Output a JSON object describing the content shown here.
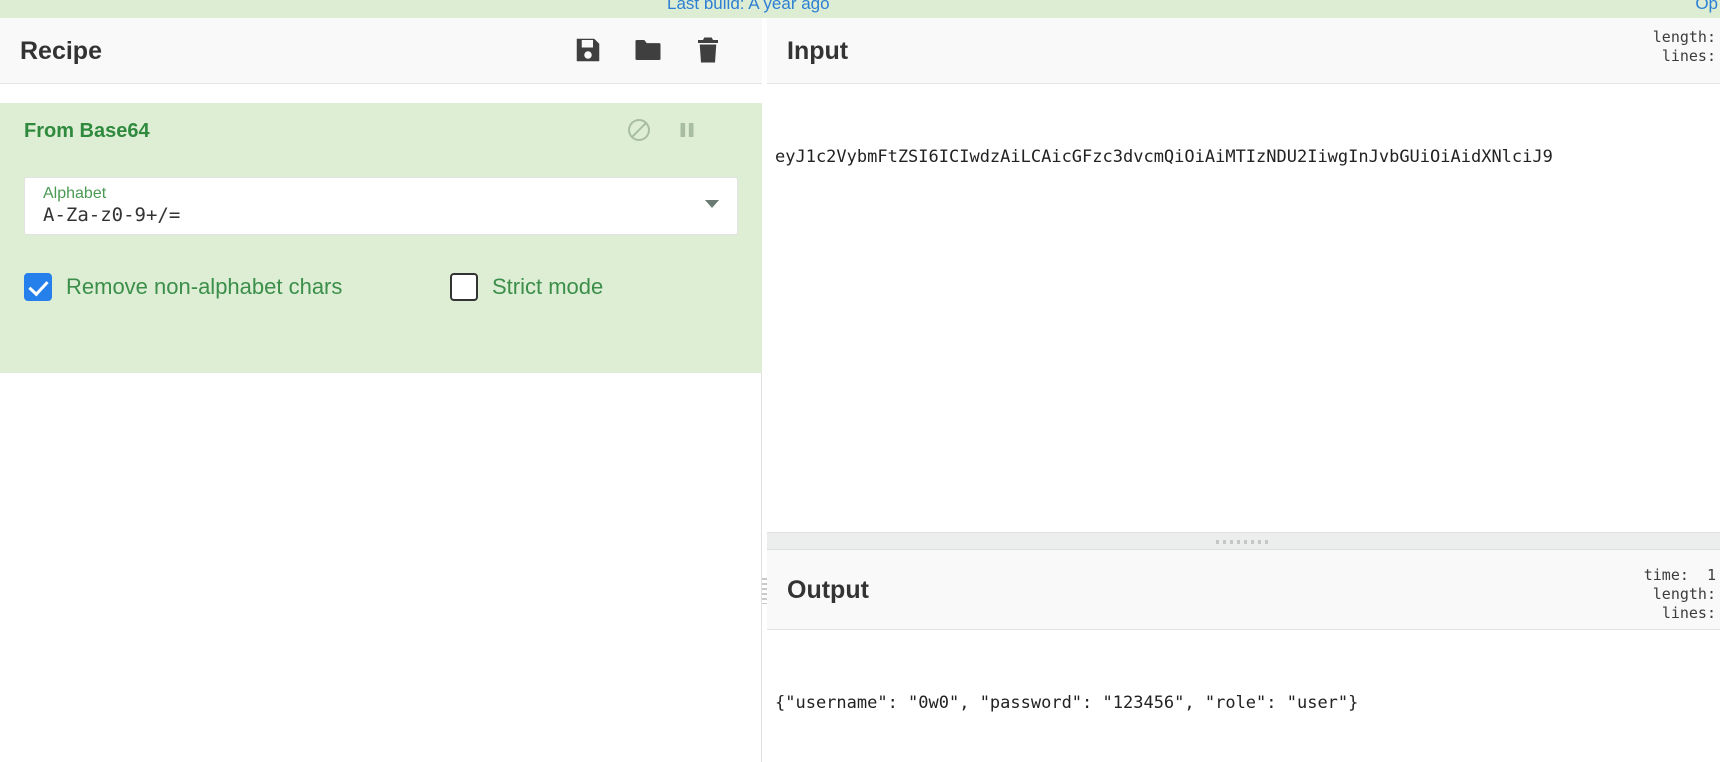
{
  "banner": {
    "build_text": "Last build: A year ago",
    "options_text": "Op",
    "link_color": "#2c7fd4",
    "background": "#dcedd4"
  },
  "recipe": {
    "title": "Recipe",
    "toolbar": [
      {
        "name": "save-recipe-icon",
        "label": "Save recipe"
      },
      {
        "name": "load-recipe-icon",
        "label": "Load recipe"
      },
      {
        "name": "clear-recipe-icon",
        "label": "Clear recipe"
      }
    ],
    "operation": {
      "name": "From Base64",
      "accent_color": "#2f8a3e",
      "background": "#ddeed4",
      "header_icons": [
        {
          "name": "disable-operation-icon",
          "label": "Disable operation"
        },
        {
          "name": "breakpoint-icon",
          "label": "Set breakpoint"
        }
      ],
      "argument": {
        "label": "Alphabet",
        "value": "A-Za-z0-9+/=",
        "type": "editable-select"
      },
      "checkboxes": [
        {
          "label": "Remove non-alphabet chars",
          "checked": true
        },
        {
          "label": "Strict mode",
          "checked": false
        }
      ]
    }
  },
  "input": {
    "title": "Input",
    "stats": [
      {
        "label": "length:",
        "value": ""
      },
      {
        "label": "lines:",
        "value": ""
      }
    ],
    "content": "eyJ1c2VybmFtZSI6ICIwdzAiLCAicGFzc3dvcmQiOiAiMTIzNDU2IiwgInJvbGUiOiAidXNlciJ9"
  },
  "output": {
    "title": "Output",
    "stats": [
      {
        "label": "time:",
        "value": "1"
      },
      {
        "label": "length:",
        "value": ""
      },
      {
        "label": "lines:",
        "value": ""
      }
    ],
    "content": "{\"username\": \"0w0\", \"password\": \"123456\", \"role\": \"user\"}"
  }
}
